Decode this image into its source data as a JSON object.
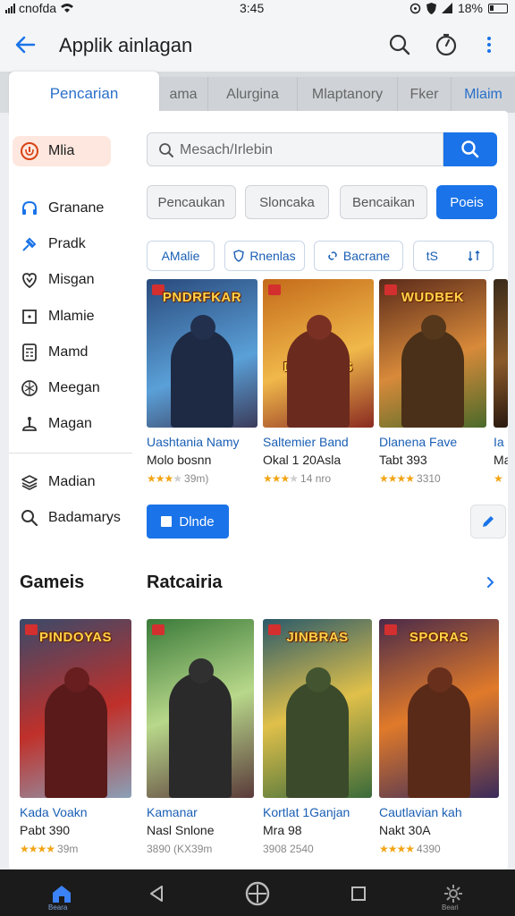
{
  "status_bar": {
    "carrier": "cnofda",
    "time": "3:45",
    "battery": "18%"
  },
  "app_bar": {
    "title": "Applik ainlagan",
    "back_icon": "arrow-back-icon",
    "actions": [
      "search-icon",
      "timer-icon",
      "more-vert-icon"
    ]
  },
  "top_tabs": {
    "active": "Pencarian",
    "others": [
      "ama",
      "Alurgina",
      "Mlaptanory",
      "Fker",
      "Mlaim"
    ]
  },
  "sidebar": {
    "items": [
      {
        "label": "Mlia",
        "icon": "shield-icon",
        "selected": true
      },
      {
        "label": "Granane",
        "icon": "headset-icon"
      },
      {
        "label": "Pradk",
        "icon": "pin-icon"
      },
      {
        "label": "Misgan",
        "icon": "heart-shield-icon"
      },
      {
        "label": "Mlamie",
        "icon": "square-dot-icon"
      },
      {
        "label": "Mamd",
        "icon": "calculator-icon"
      },
      {
        "label": "Meegan",
        "icon": "globe-icon"
      },
      {
        "label": "Magan",
        "icon": "joystick-icon"
      },
      {
        "label": "Madian",
        "icon": "layers-icon"
      },
      {
        "label": "Badamarys",
        "icon": "search-icon"
      }
    ]
  },
  "search": {
    "placeholder": "Mesach/Irlebin"
  },
  "filters": [
    {
      "label": "Pencaukan"
    },
    {
      "label": "Sloncaka"
    },
    {
      "label": "Bencaikan"
    },
    {
      "label": "Poeis",
      "active": true
    }
  ],
  "tags": [
    {
      "label": "AMalie"
    },
    {
      "label": "Rnenlas"
    },
    {
      "label": "Bacrane"
    },
    {
      "label": "tS"
    }
  ],
  "featured_games": [
    {
      "logo": "PNDRFKAR",
      "name": "Uashtania Namy",
      "sub": "Molo bosnn",
      "stars": 3,
      "meta": "39m)",
      "colors": [
        "#2a4a7c",
        "#5aa0d8",
        "#3b3b5a"
      ]
    },
    {
      "logo": "DUSSOAS",
      "name": "Saltemier Band",
      "sub": "Okal 1 20Asla",
      "stars": 3,
      "meta": "14 nro",
      "colors": [
        "#c46a1a",
        "#f0b84a",
        "#8a2a22"
      ]
    },
    {
      "logo": "WUDBEK",
      "name": "Dlanena Fave",
      "sub": "Tabt 393",
      "stars": 4,
      "meta": "3310",
      "colors": [
        "#5a2a1a",
        "#d88a3a",
        "#4a6a2a"
      ]
    },
    {
      "logo": "",
      "name": "Ia",
      "sub": "Ma",
      "stars": 1,
      "meta": "",
      "colors": [
        "#3a2a1a",
        "#8a5a2a",
        "#2a1a10"
      ]
    }
  ],
  "install_label": "Dlnde",
  "sections": {
    "games": "Gameis",
    "ratings": "Ratcairia"
  },
  "game_grid": [
    {
      "logo": "PINDOYAS",
      "name": "Kada Voakn",
      "sub": "Pabt 390",
      "stars": 4,
      "meta": "39m",
      "colors": [
        "#3a4a6a",
        "#c0302a",
        "#8aa0b8"
      ]
    },
    {
      "logo": "",
      "name": "Kamanar",
      "sub": "Nasl Snlone",
      "stars": 0,
      "meta": "3890 (KX39m",
      "colors": [
        "#3a7a3a",
        "#b8d88a",
        "#5a3a3a"
      ]
    },
    {
      "logo": "JINBRAS",
      "name": "Kortlat 1Ganjan",
      "sub": "Mra 98",
      "stars": 0,
      "meta": "3908 2540",
      "colors": [
        "#2a5a6a",
        "#e0c04a",
        "#3a6a3a"
      ]
    },
    {
      "logo": "SPORAS",
      "name": "Cautlavian kah",
      "sub": "Nakt 30A",
      "stars": 4,
      "meta": "4390",
      "colors": [
        "#4a2a4a",
        "#e07a2a",
        "#3a2a5a"
      ]
    }
  ],
  "bottom_nav": {
    "home_label": "Beara",
    "settings_label": "Beari"
  }
}
